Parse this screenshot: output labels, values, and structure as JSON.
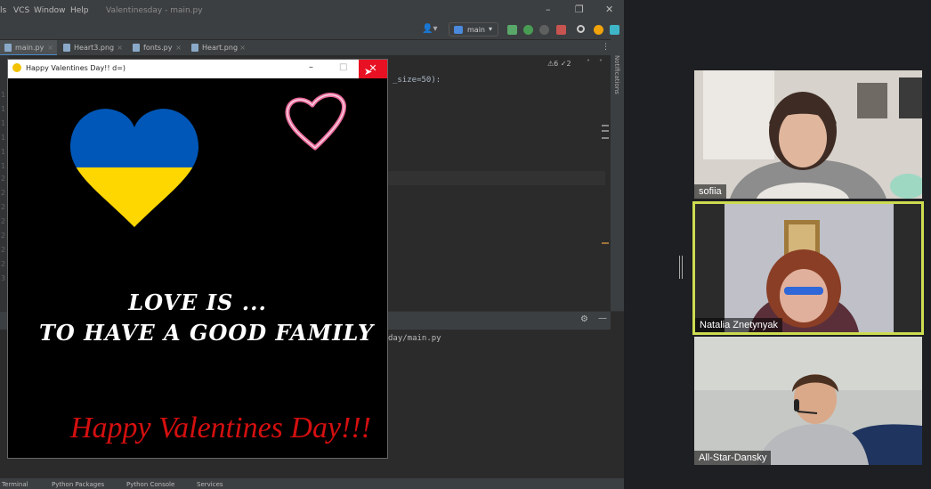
{
  "ide": {
    "menu": [
      "ls",
      "VCS",
      "Window",
      "Help"
    ],
    "window_title": "Valentinesday - main.py",
    "branch": "main",
    "tabs": [
      "main.py",
      "Heart3.png",
      "fonts.py",
      "Heart.png"
    ],
    "inspections": "⚠6 ✓2",
    "code_fragment": "_size=50):",
    "run_path": "day/main.py",
    "notifications_label": "Notifications",
    "bottom_tabs": [
      "Terminal",
      "Python Packages",
      "Python Console",
      "Services"
    ]
  },
  "game_window": {
    "title": "Happy Valentines Day!! d=)",
    "line1": "LOVE IS ...",
    "line2": "TO HAVE A GOOD FAMILY",
    "greeting": "Happy Valentines Day!!!",
    "colors": {
      "heart_top": "#0057b7",
      "heart_bottom": "#ffd700",
      "greeting": "#d40f0f",
      "outline_heart": "#e86a9a"
    }
  },
  "meeting": {
    "participants": [
      {
        "name": "sofiia",
        "active_speaker": false
      },
      {
        "name": "Natalia Znetynyak",
        "active_speaker": true
      },
      {
        "name": "All-Star-Dansky",
        "active_speaker": false
      }
    ],
    "speaker_highlight_color": "#cddc50"
  }
}
